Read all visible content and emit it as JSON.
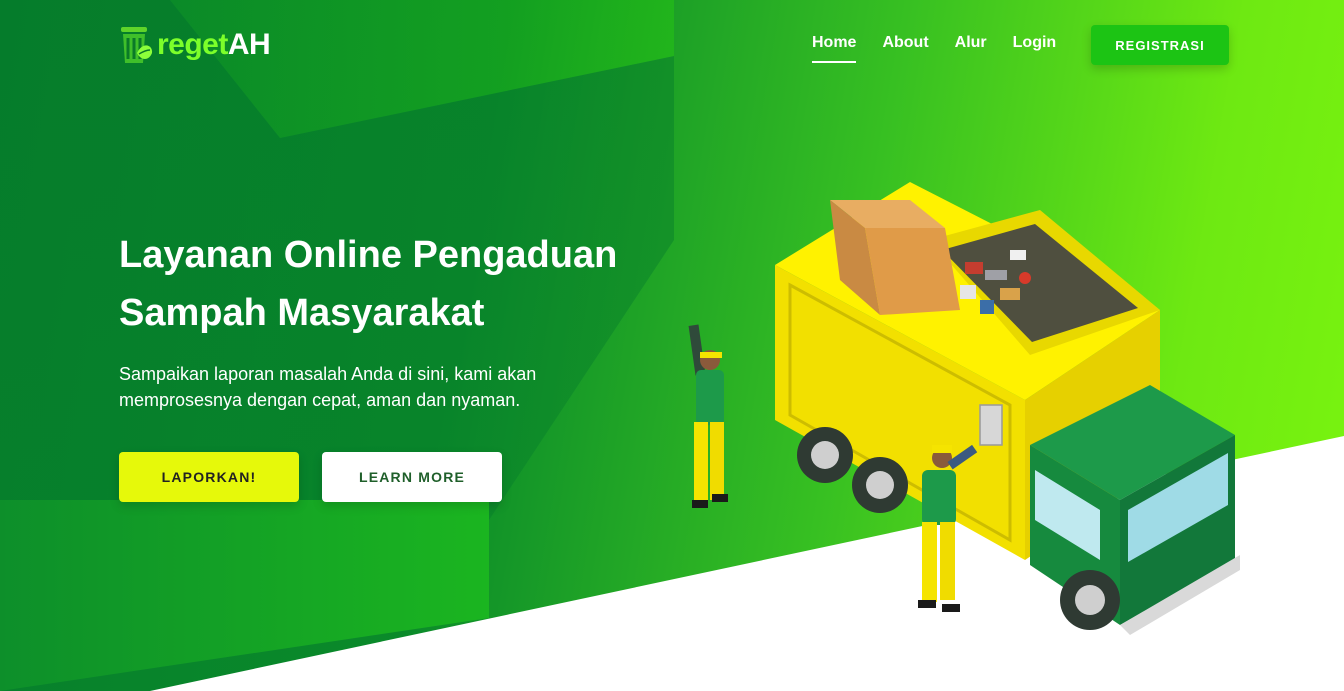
{
  "brand": {
    "name_part1": "reget",
    "name_part2": "AH",
    "logo_icon": "trash-can-leaf-icon"
  },
  "nav": {
    "items": [
      {
        "label": "Home",
        "active": true
      },
      {
        "label": "About",
        "active": false
      },
      {
        "label": "Alur",
        "active": false
      },
      {
        "label": "Login",
        "active": false
      }
    ],
    "register_label": "REGISTRASI"
  },
  "hero": {
    "title_line1": "Layanan Online Pengaduan",
    "title_line2": "Sampah Masyarakat",
    "subtitle_line1": "Sampaikan laporan masalah Anda di sini, kami akan",
    "subtitle_line2": "memprosesnya dengan cepat, aman dan nyaman.",
    "primary_button": "LAPORKAN!",
    "secondary_button": "LEARN MORE"
  },
  "illustration": {
    "icon": "garbage-truck-illustration"
  },
  "colors": {
    "primary_green": "#0a8a2a",
    "accent_lime": "#7af50f",
    "register_button": "#1cc414",
    "cta_yellow": "#e6f90a",
    "truck_yellow": "#f5e400",
    "truck_cab_green": "#168a3e"
  }
}
